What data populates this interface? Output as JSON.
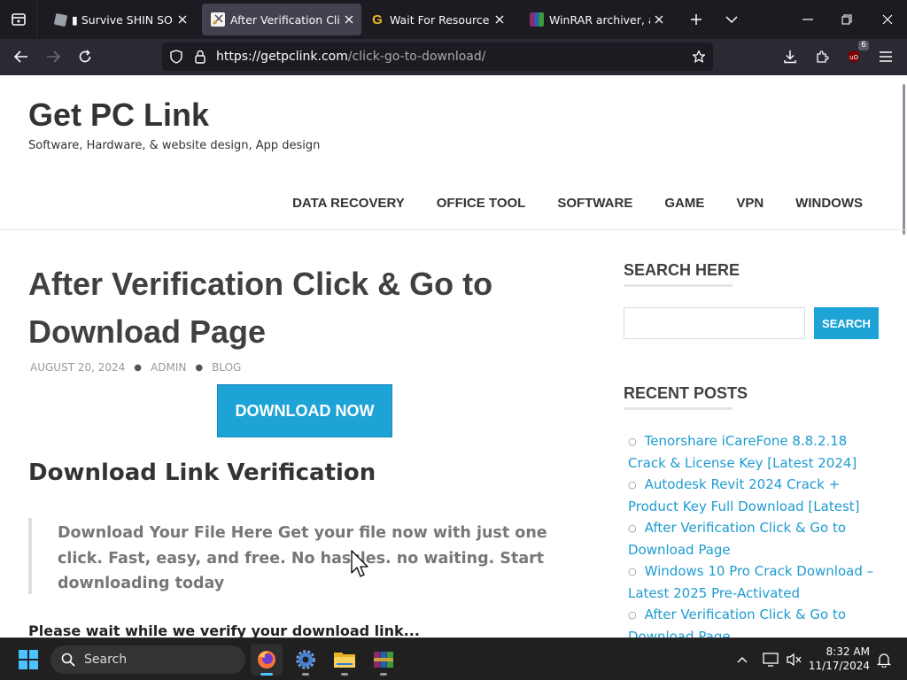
{
  "browser": {
    "tabs": [
      {
        "title": "▮ Survive SHIN SONIC",
        "icon": "roblox-icon",
        "active": false
      },
      {
        "title": "After Verification Click",
        "icon": "getpclink-favicon",
        "active": true
      },
      {
        "title": "Wait For Resource - iGe",
        "icon": "g-favicon",
        "active": false
      },
      {
        "title": "WinRAR archiver, a pow",
        "icon": "winrar-icon",
        "active": false
      }
    ],
    "url_host": "https://getpclink.com",
    "url_path": "/click-go-to-download/",
    "extension_badge": "6"
  },
  "page": {
    "site_title": "Get PC Link",
    "tagline": "Software, Hardware, & website design, App design",
    "menu": [
      "DATA RECOVERY",
      "OFFICE TOOL",
      "SOFTWARE",
      "GAME",
      "VPN",
      "WINDOWS"
    ],
    "post": {
      "title": "After Verification Click & Go to Download Page",
      "date": "AUGUST 20, 2024",
      "author": "ADMIN",
      "category": "BLOG",
      "download_button": "DOWNLOAD NOW",
      "section_heading": "Download Link Verification",
      "quote": "Download Your File Here Get your file now with just one click. Fast, easy, and free. No hassles. no waiting. Start downloading today",
      "wait_text": "Please wait while we verify your download link..."
    },
    "sidebar": {
      "search_heading": "SEARCH HERE",
      "search_button": "SEARCH",
      "search_value": "",
      "recent_heading": "RECENT POSTS",
      "recent_posts": [
        "Tenorshare iCareFone 8.8.2.18 Crack & License Key [Latest 2024]",
        "Autodesk Revit 2024 Crack + Product Key Full Download [Latest]",
        "After Verification Click & Go to Download Page",
        "Windows 10 Pro Crack Download – Latest 2025 Pre-Activated",
        "After Verification Click & Go to Download Page"
      ]
    }
  },
  "taskbar": {
    "search_label": "Search",
    "time": "8:32 AM",
    "date": "11/17/2024"
  },
  "colors": {
    "accent": "#1ea3d6",
    "link": "#1e9bd0",
    "browser_bg": "#1c1b22",
    "toolbar_bg": "#2b2a33"
  }
}
